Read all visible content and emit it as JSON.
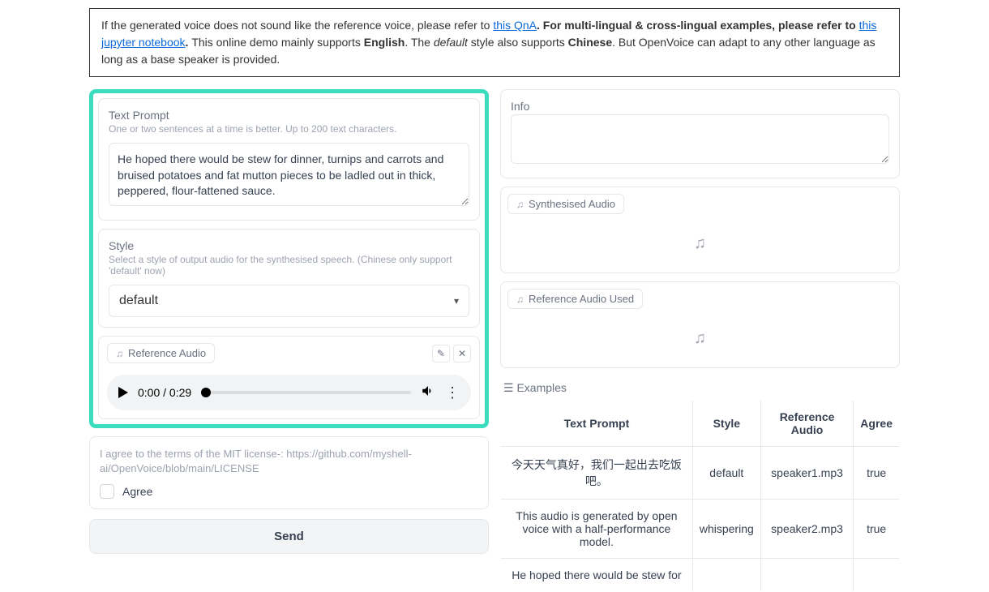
{
  "notice": {
    "prefix": "If the generated voice does not sound like the reference voice, please refer to ",
    "link1": "this QnA",
    "between1": ". For multi-lingual & cross-lingual examples, please refer to ",
    "link2": "this jupyter notebook",
    "after_link2": ". ",
    "text2": "This online demo mainly supports ",
    "english": "English",
    "text3": ". The ",
    "default_word": "default",
    "text4": " style also supports ",
    "chinese": "Chinese",
    "text5": ". But OpenVoice can adapt to any other language as long as a base speaker is provided."
  },
  "text_prompt": {
    "label": "Text Prompt",
    "hint": "One or two sentences at a time is better. Up to 200 text characters.",
    "value": "He hoped there would be stew for dinner, turnips and carrots and bruised potatoes and fat mutton pieces to be ladled out in thick, peppered, flour-fattened sauce."
  },
  "style": {
    "label": "Style",
    "hint": "Select a style of output audio for the synthesised speech. (Chinese only support 'default' now)",
    "value": "default"
  },
  "reference_audio": {
    "tab_label": "Reference Audio",
    "time_display": "0:00 / 0:29"
  },
  "license": {
    "text": "I agree to the terms of the MIT license-: https://github.com/myshell-ai/OpenVoice/blob/main/LICENSE",
    "checkbox_label": "Agree"
  },
  "send_label": "Send",
  "info": {
    "label": "Info",
    "value": ""
  },
  "synth_audio": {
    "tab_label": "Synthesised Audio"
  },
  "ref_audio_used": {
    "tab_label": "Reference Audio Used"
  },
  "examples": {
    "label": "☰ Examples",
    "headers": {
      "prompt": "Text Prompt",
      "style": "Style",
      "ref": "Reference Audio",
      "agree": "Agree"
    },
    "rows": [
      {
        "prompt": "今天天气真好，我们一起出去吃饭吧。",
        "style": "default",
        "ref": "speaker1.mp3",
        "agree": "true"
      },
      {
        "prompt": "This audio is generated by open voice with a half-performance model.",
        "style": "whispering",
        "ref": "speaker2.mp3",
        "agree": "true"
      },
      {
        "prompt": "He hoped there would be stew for",
        "style": "",
        "ref": "",
        "agree": ""
      }
    ]
  },
  "icons": {
    "music": "♫",
    "edit": "✎",
    "close": "✕",
    "caret": "▾",
    "dots": "⋮"
  }
}
